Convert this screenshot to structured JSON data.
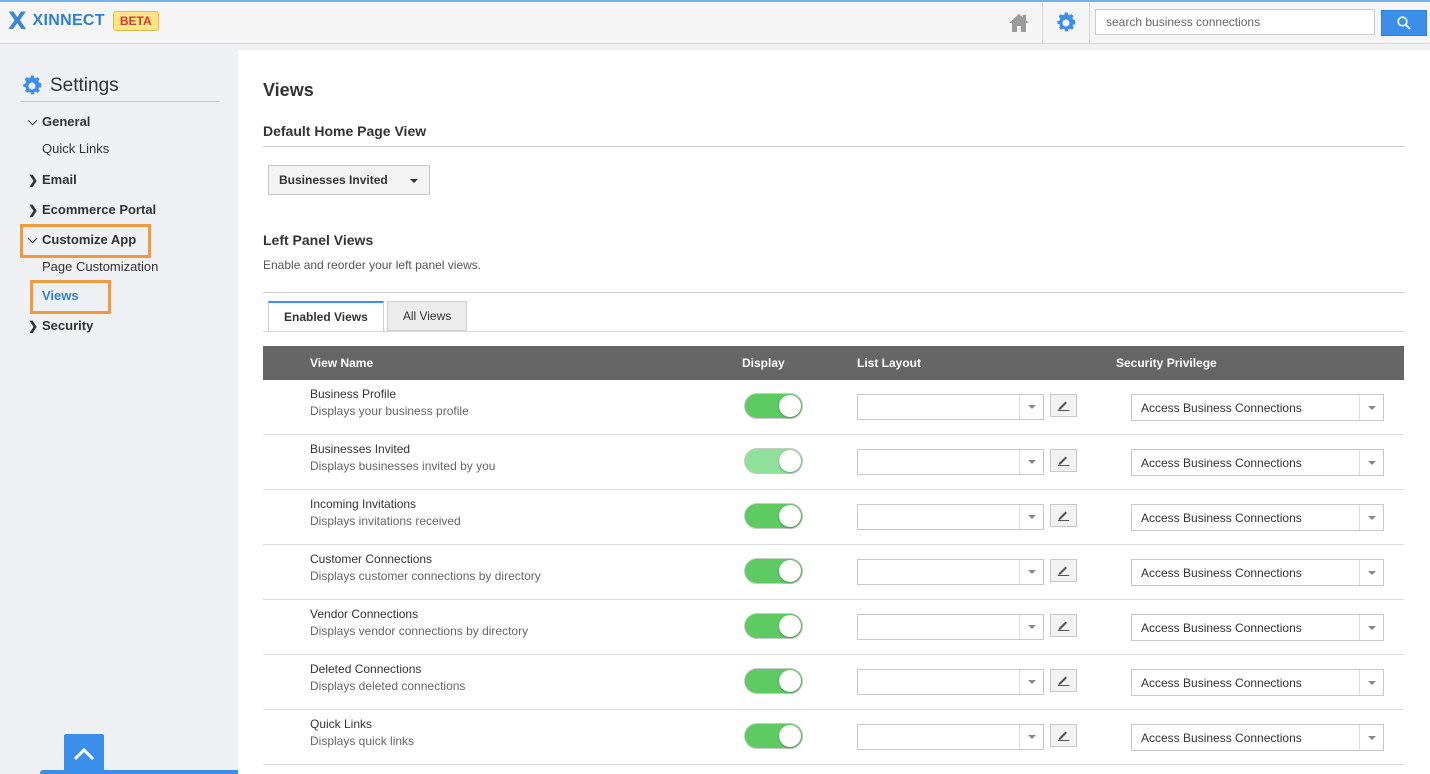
{
  "app": {
    "logo_glyph": "X",
    "name": "XINNECT",
    "badge": "BETA",
    "brand_color": "#2f7fd4",
    "accent_color": "#3b8eea",
    "highlight_color": "#ef9a3c"
  },
  "header": {
    "home_icon": "home-icon",
    "settings_icon": "gear-icon",
    "search_placeholder": "search business connections",
    "search_icon": "search-icon"
  },
  "sidebar": {
    "title": "Settings",
    "sections": [
      {
        "label": "General",
        "expanded": true,
        "children": [
          "Quick Links"
        ]
      },
      {
        "label": "Email",
        "expanded": false
      },
      {
        "label": "Ecommerce Portal",
        "expanded": false
      },
      {
        "label": "Customize App",
        "expanded": true,
        "highlighted": true,
        "children": [
          "Page Customization",
          "Views"
        ]
      },
      {
        "label": "Security",
        "expanded": false
      }
    ],
    "active_item": "Views"
  },
  "main": {
    "title": "Views",
    "default_view": {
      "title": "Default Home Page View",
      "selected": "Businesses Invited"
    },
    "left_panel": {
      "title": "Left Panel Views",
      "description": "Enable and reorder your left panel views.",
      "tabs": [
        "Enabled Views",
        "All Views"
      ],
      "active_tab": "Enabled Views"
    },
    "table": {
      "columns": [
        "View Name",
        "Display",
        "List Layout",
        "Security Privilege"
      ],
      "rows": [
        {
          "name": "Business Profile",
          "description": "Displays your business profile",
          "display": true,
          "list_layout": "",
          "privilege": "Access Business Connections"
        },
        {
          "name": "Businesses Invited",
          "description": "Displays businesses invited by you",
          "display": true,
          "list_layout": "",
          "privilege": "Access Business Connections"
        },
        {
          "name": "Incoming Invitations",
          "description": "Displays invitations received",
          "display": true,
          "list_layout": "",
          "privilege": "Access Business Connections"
        },
        {
          "name": "Customer Connections",
          "description": "Displays customer connections by directory",
          "display": true,
          "list_layout": "",
          "privilege": "Access Business Connections"
        },
        {
          "name": "Vendor Connections",
          "description": "Displays vendor connections by directory",
          "display": true,
          "list_layout": "",
          "privilege": "Access Business Connections"
        },
        {
          "name": "Deleted Connections",
          "description": "Displays deleted connections",
          "display": true,
          "list_layout": "",
          "privilege": "Access Business Connections"
        },
        {
          "name": "Quick Links",
          "description": "Displays quick links",
          "display": true,
          "list_layout": "",
          "privilege": "Access Business Connections"
        }
      ]
    }
  }
}
